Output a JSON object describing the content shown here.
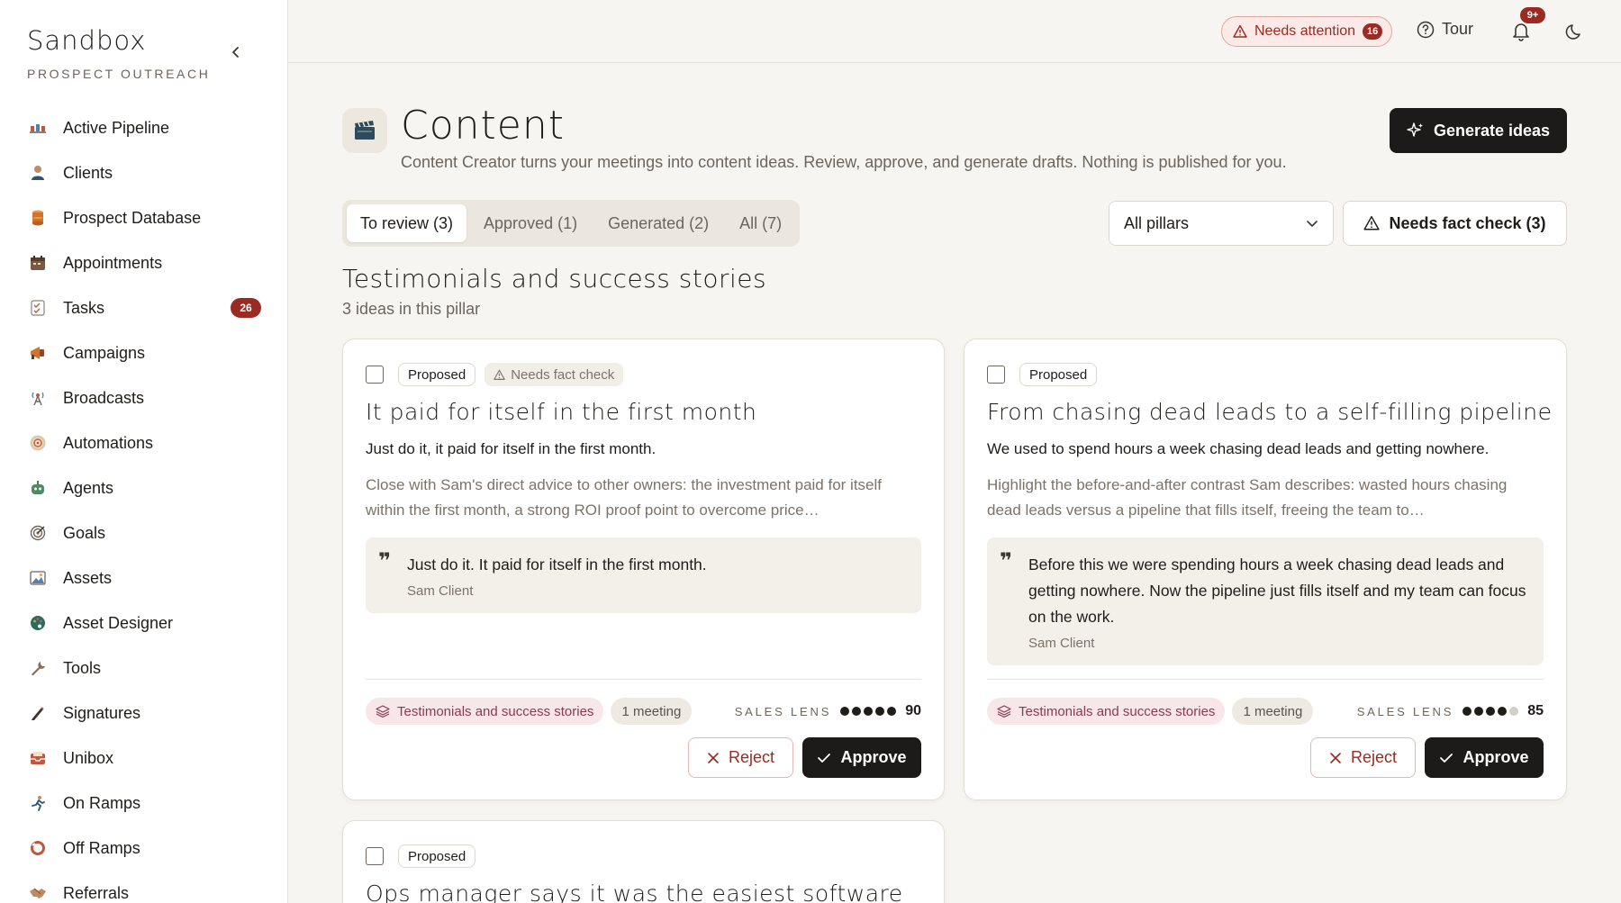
{
  "app": {
    "brand_title": "Sandbox",
    "brand_subtitle": "PROSPECT OUTREACH"
  },
  "sidebar": {
    "items": [
      {
        "label": "Active Pipeline",
        "icon": "pipeline-icon"
      },
      {
        "label": "Clients",
        "icon": "person-icon"
      },
      {
        "label": "Prospect Database",
        "icon": "database-icon"
      },
      {
        "label": "Appointments",
        "icon": "calendar-icon"
      },
      {
        "label": "Tasks",
        "icon": "checklist-icon",
        "badge": "26"
      },
      {
        "label": "Campaigns",
        "icon": "megaphone-icon"
      },
      {
        "label": "Broadcasts",
        "icon": "antenna-icon"
      },
      {
        "label": "Automations",
        "icon": "cog-target-icon"
      },
      {
        "label": "Agents",
        "icon": "robot-icon"
      },
      {
        "label": "Goals",
        "icon": "target-icon"
      },
      {
        "label": "Assets",
        "icon": "image-icon"
      },
      {
        "label": "Asset Designer",
        "icon": "palette-icon"
      },
      {
        "label": "Tools",
        "icon": "wrench-icon"
      },
      {
        "label": "Signatures",
        "icon": "pen-icon"
      },
      {
        "label": "Unibox",
        "icon": "inbox-icon"
      },
      {
        "label": "On Ramps",
        "icon": "runner-icon"
      },
      {
        "label": "Off Ramps",
        "icon": "ring-icon"
      },
      {
        "label": "Referrals",
        "icon": "handshake-icon"
      }
    ]
  },
  "topbar": {
    "attention_label": "Needs attention",
    "attention_count": "16",
    "tour_label": "Tour",
    "notification_badge": "9+"
  },
  "header": {
    "title": "Content",
    "subtitle": "Content Creator turns your meetings into content ideas. Review, approve, and generate drafts. Nothing is published for you.",
    "generate_label": "Generate ideas"
  },
  "tabs": [
    {
      "label": "To review (3)",
      "active": true
    },
    {
      "label": "Approved (1)",
      "active": false
    },
    {
      "label": "Generated (2)",
      "active": false
    },
    {
      "label": "All (7)",
      "active": false
    }
  ],
  "filters": {
    "pillar_selected": "All pillars",
    "factcheck_label": "Needs fact check (3)"
  },
  "section": {
    "title": "Testimonials and success stories",
    "subtitle": "3 ideas in this pillar"
  },
  "cards": [
    {
      "status": "Proposed",
      "fact_check": "Needs fact check",
      "title": "It paid for itself in the first month",
      "hook": "Just do it, it paid for itself in the first month.",
      "description": "Close with Sam's direct advice to other owners: the investment paid for itself within the first month, a strong ROI proof point to overcome price…",
      "quote": "Just do it. It paid for itself in the first month.",
      "quote_author": "Sam Client",
      "pillar": "Testimonials and success stories",
      "meetings": "1 meeting",
      "lens_label": "SALES LENS",
      "lens_score": "90",
      "lens_dots": 5,
      "reject_label": "Reject",
      "approve_label": "Approve"
    },
    {
      "status": "Proposed",
      "title": "From chasing dead leads to a self-filling pipeline",
      "hook": "We used to spend hours a week chasing dead leads and getting nowhere.",
      "description": "Highlight the before-and-after contrast Sam describes: wasted hours chasing dead leads versus a pipeline that fills itself, freeing the team to…",
      "quote": "Before this we were spending hours a week chasing dead leads and getting nowhere. Now the pipeline just fills itself and my team can focus on the work.",
      "quote_author": "Sam Client",
      "pillar": "Testimonials and success stories",
      "meetings": "1 meeting",
      "lens_label": "SALES LENS",
      "lens_score": "85",
      "lens_dots": 4,
      "reject_label": "Reject",
      "approve_label": "Approve"
    },
    {
      "status": "Proposed",
      "title": "Ops manager says it was the easiest software"
    }
  ],
  "colors": {
    "accent_dark": "#1c1b19",
    "danger": "#9a2a22",
    "pillar_bg": "#f7e6ea",
    "pillar_text": "#8a3b52"
  }
}
